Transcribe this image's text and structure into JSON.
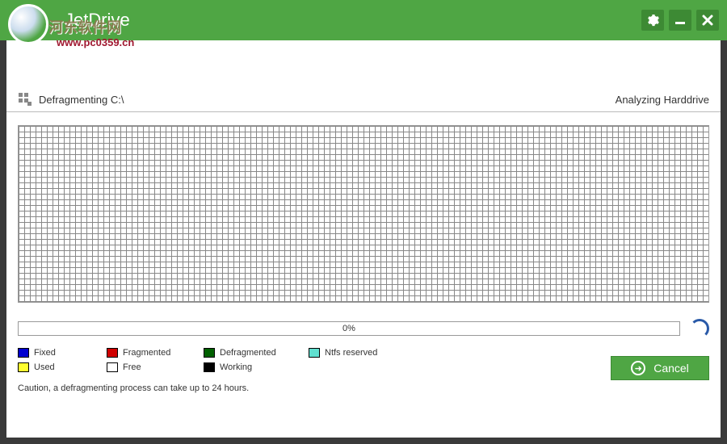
{
  "app": {
    "title": "JetDrive"
  },
  "watermark": {
    "text": "河东软件网",
    "url": "www.pc0359.cn"
  },
  "status": {
    "left": "Defragmenting C:\\",
    "right": "Analyzing Harddrive"
  },
  "progress": {
    "percent_text": "0%"
  },
  "legend": {
    "fixed": {
      "label": "Fixed",
      "color": "#0000d0"
    },
    "fragmented": {
      "label": "Fragmented",
      "color": "#d00000"
    },
    "defragmented": {
      "label": "Defragmented",
      "color": "#006000"
    },
    "ntfs_reserved": {
      "label": "Ntfs reserved",
      "color": "#60e0d0"
    },
    "used": {
      "label": "Used",
      "color": "#ffff30"
    },
    "free": {
      "label": "Free",
      "color": "#ffffff"
    },
    "working": {
      "label": "Working",
      "color": "#000000"
    }
  },
  "buttons": {
    "cancel": "Cancel"
  },
  "caution": "Caution, a defragmenting process can take up to 24 hours."
}
